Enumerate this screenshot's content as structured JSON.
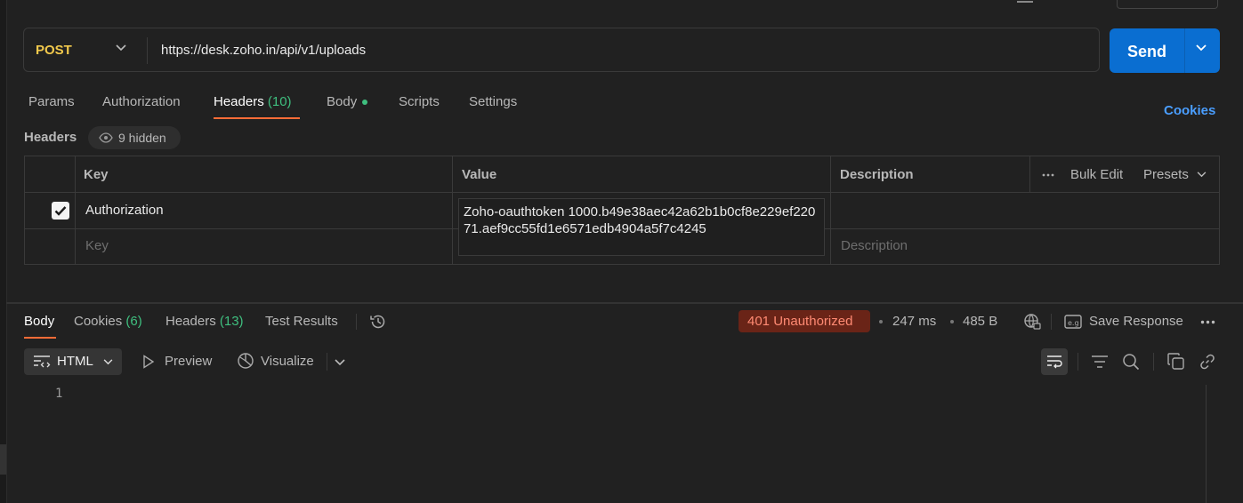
{
  "request": {
    "method": "POST",
    "url": "https://desk.zoho.in/api/v1/uploads",
    "send_label": "Send"
  },
  "request_tabs": [
    {
      "label": "Params"
    },
    {
      "label": "Authorization"
    },
    {
      "label": "Headers",
      "count": "(10)"
    },
    {
      "label": "Body"
    },
    {
      "label": "Scripts"
    },
    {
      "label": "Settings"
    }
  ],
  "cookies_link": "Cookies",
  "headers_section": {
    "title": "Headers",
    "hidden_label": "9 hidden"
  },
  "headers_table": {
    "columns": [
      "Key",
      "Value",
      "Description"
    ],
    "bulk_edit": "Bulk Edit",
    "presets": "Presets",
    "rows": [
      {
        "checked": true,
        "key": "Authorization",
        "value": "Zoho-oauthtoken 1000.b49e38aec42a62b1b0cf8e229ef22071.aef9cc55fd1e6571edb4904a5f7c4245"
      }
    ],
    "placeholder_key": "Key",
    "placeholder_description": "Description"
  },
  "response_tabs": [
    {
      "label": "Body"
    },
    {
      "label": "Cookies",
      "count": "(6)"
    },
    {
      "label": "Headers",
      "count": "(13)"
    },
    {
      "label": "Test Results"
    }
  ],
  "response_meta": {
    "status": "401 Unauthorized",
    "time": "247 ms",
    "size": "485 B",
    "save_response": "Save Response"
  },
  "response_toolbar": {
    "format": "HTML",
    "preview": "Preview",
    "visualize": "Visualize"
  },
  "response_body": {
    "line_numbers": [
      "1"
    ]
  },
  "colors": {
    "accent_orange": "#ff6c37",
    "send_blue": "#0a6ed1",
    "method_yellow": "#f2c94c",
    "link_blue": "#4a9eff",
    "status_error_bg": "#6a2417",
    "status_error_text": "#ff8a73",
    "count_green": "#3fbf7f"
  }
}
